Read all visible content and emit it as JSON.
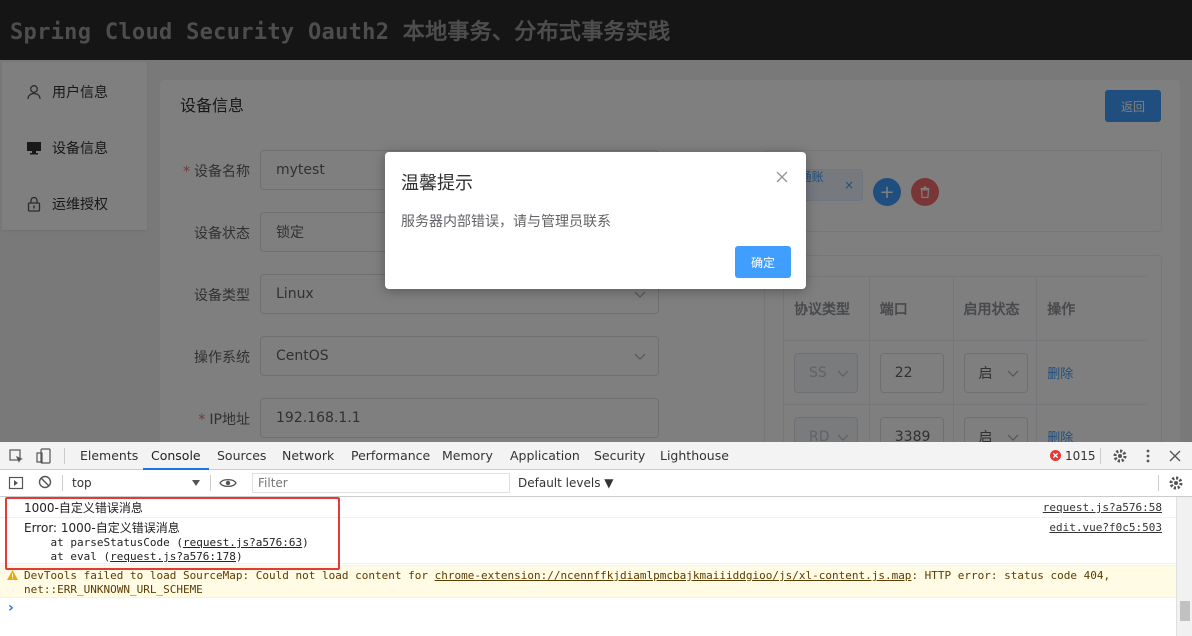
{
  "header": {
    "title": "Spring Cloud Security Oauth2 本地事务、分布式事务实践"
  },
  "sidebar": {
    "items": [
      {
        "label": "用户信息",
        "icon": "user-icon"
      },
      {
        "label": "设备信息",
        "icon": "monitor-icon"
      },
      {
        "label": "运维授权",
        "icon": "lock-icon"
      }
    ]
  },
  "card": {
    "title": "设备信息",
    "back_label": "返回",
    "form": [
      {
        "label": "设备名称",
        "required": true,
        "value": "mytest"
      },
      {
        "label": "设备状态",
        "required": false,
        "value": "锁定"
      },
      {
        "label": "设备类型",
        "required": false,
        "value": "Linux"
      },
      {
        "label": "操作系统",
        "required": false,
        "value": "CentOS"
      },
      {
        "label": "IP地址",
        "required": true,
        "value": "192.168.1.1"
      }
    ],
    "tag": {
      "text": "ort(普通账号)",
      "close": "×"
    },
    "add_label": "+",
    "table": {
      "headers": [
        "协议类型",
        "端口",
        "启用状态",
        "操作"
      ],
      "rows": [
        {
          "protocol": "SS",
          "port": "22",
          "status": "启",
          "action": "删除"
        },
        {
          "protocol": "RD",
          "port": "3389",
          "status": "启",
          "action": "删除"
        }
      ]
    }
  },
  "dialog": {
    "title": "温馨提示",
    "message": "服务器内部错误，请与管理员联系",
    "ok_label": "确定"
  },
  "devtools": {
    "tabs": [
      "Elements",
      "Console",
      "Sources",
      "Network",
      "Performance",
      "Memory",
      "Application",
      "Security",
      "Lighthouse"
    ],
    "active_tab": "Console",
    "error_count": "1015",
    "context": "top",
    "filter_placeholder": "Filter",
    "levels": "Default levels ▼",
    "console": {
      "msg1": "1000-自定义错误消息",
      "msg1_src": "request.js?a576:58",
      "err_line1": "Error: 1000-自定义错误消息",
      "err_line2_pre": "    at parseStatusCode (",
      "err_line2_link": "request.js?a576:63",
      "err_line3_pre": "    at eval (",
      "err_line3_link": "request.js?a576:178",
      "close_paren": ")",
      "err_src": "edit.vue?f0c5:503",
      "warn_pre": "DevTools failed to load SourceMap: Could not load content for ",
      "warn_link": "chrome-extension://ncennffkjdiamlpmcbajkmaiiiddgioo/js/xl-content.js.map",
      "warn_post": ": HTTP error: status code 404,",
      "warn_line2": "net::ERR_UNKNOWN_URL_SCHEME",
      "prompt": "›"
    }
  }
}
